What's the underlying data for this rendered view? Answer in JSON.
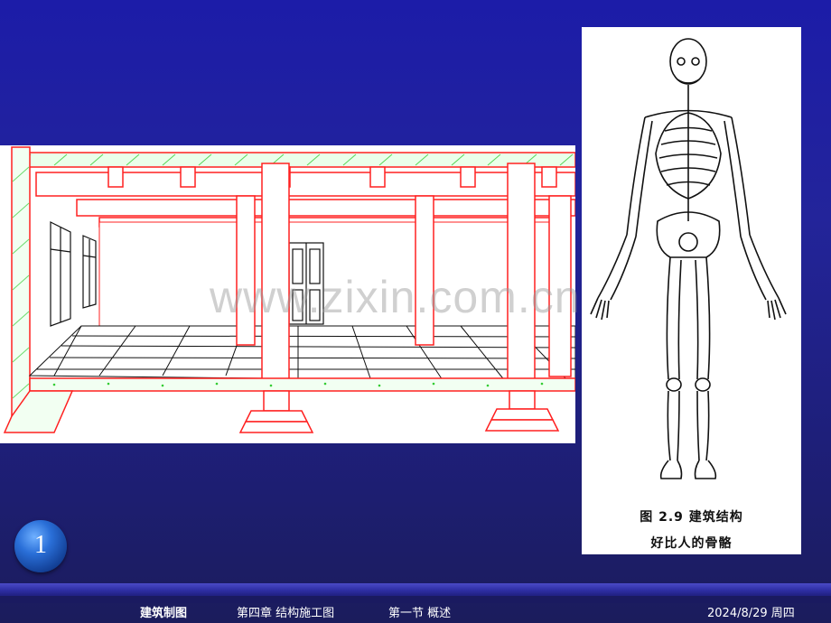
{
  "footer": {
    "course": "建筑制图",
    "chapter": "第四章   结构施工图",
    "section": "第一节   概述",
    "date": "2024/8/29 周四"
  },
  "page_number": "1",
  "figure": {
    "caption_line1": "图 2.9  建筑结构",
    "caption_line2": "好比人的骨骼"
  },
  "watermark": "www.zixin.com.cn",
  "colors": {
    "background": "#1f1f8c",
    "structure_lines": "#ff2020",
    "slab_hatch": "#22cc22",
    "badge": "#2a6fd8"
  }
}
